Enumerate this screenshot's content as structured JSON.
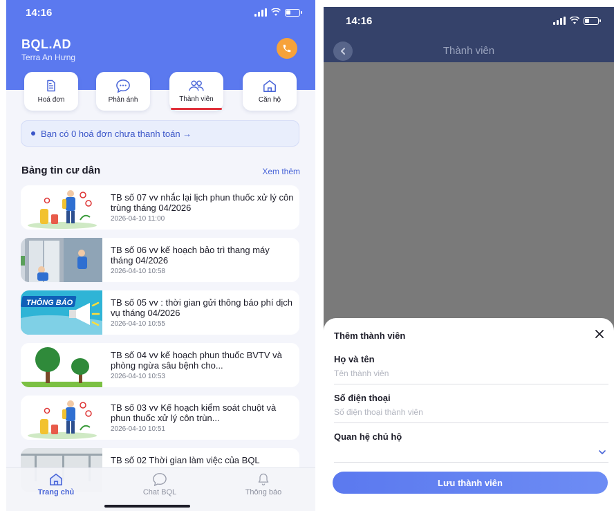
{
  "left": {
    "status_time": "14:16",
    "brand_name": "BQL.AD",
    "brand_sub": "Terra An Hưng",
    "menu": [
      {
        "label": "Hoá đơn",
        "icon": "invoice-icon"
      },
      {
        "label": "Phản ánh",
        "icon": "chat-bubble-icon"
      },
      {
        "label": "Thành viên",
        "icon": "members-icon"
      },
      {
        "label": "Căn hộ",
        "icon": "home-icon"
      }
    ],
    "notice": "Bạn có 0 hoá đơn chưa thanh toán →",
    "news_title": "Bảng tin cư dân",
    "news_more": "Xem thêm",
    "news": [
      {
        "title": "TB số 07 vv nhắc lại lịch phun thuốc xử lý côn trùng tháng 04/2026",
        "date": "2026-04-10 11:00"
      },
      {
        "title": "TB số 06 vv kế hoạch bảo trì thang máy tháng 04/2026",
        "date": "2026-04-10 10:58"
      },
      {
        "title": "TB số 05 vv : thời gian gửi thông báo phí dịch vụ tháng 04/2026",
        "date": "2026-04-10 10:55",
        "thumb_text": "THÔNG BÁO"
      },
      {
        "title": "TB số 04 vv kế hoạch phun thuốc BVTV và phòng ngừa sâu bệnh cho...",
        "date": "2026-04-10 10:53"
      },
      {
        "title": "TB số 03 vv Kế hoạch kiểm soát chuột và phun thuốc xử lý côn trùn...",
        "date": "2026-04-10 10:51"
      },
      {
        "title": "TB số 02 Thời gian làm việc của BQL",
        "date": ""
      }
    ],
    "tabs": [
      {
        "label": "Trang chủ",
        "icon": "home-icon"
      },
      {
        "label": "Chat BQL",
        "icon": "chat-bubble-icon"
      },
      {
        "label": "Thông báo",
        "icon": "bell-icon"
      }
    ]
  },
  "right": {
    "status_time": "14:16",
    "header_title": "Thành viên",
    "sheet_title": "Thêm thành viên",
    "name_label": "Họ và tên",
    "name_placeholder": "Tên thành viên",
    "phone_label": "Số điện thoại",
    "phone_placeholder": "Số điện thoại thành viên",
    "relation_label": "Quan hệ chủ hộ",
    "relation_value": "",
    "save_label": "Lưu thành viên"
  },
  "colors": {
    "primary": "#5b79ef",
    "accent_orange": "#f7a23a",
    "active_underline": "#e0303a",
    "overlay": "#7a7a7a"
  }
}
